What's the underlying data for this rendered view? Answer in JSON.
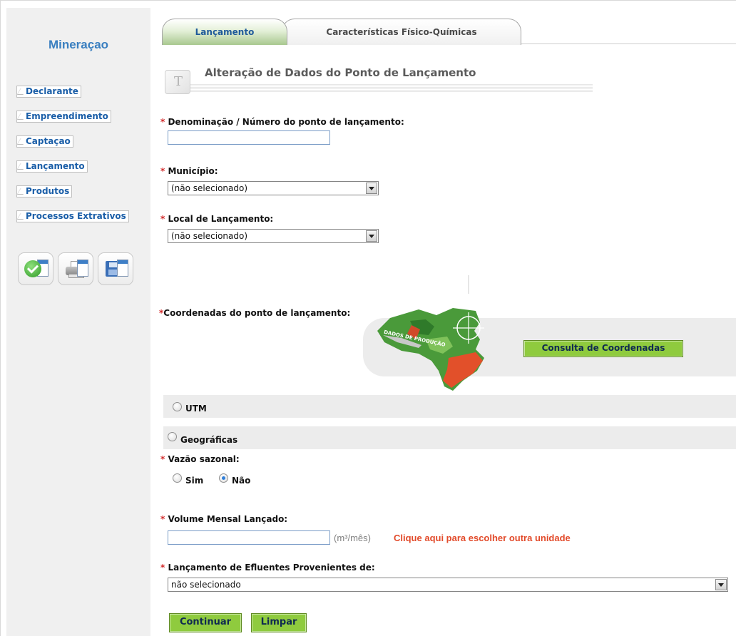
{
  "sidebar": {
    "title": "Mineraçao",
    "items": [
      {
        "label": "Declarante"
      },
      {
        "label": "Empreendimento"
      },
      {
        "label": "Captaçao"
      },
      {
        "label": "Lançamento"
      },
      {
        "label": "Produtos"
      },
      {
        "label": "Processos Extrativos"
      }
    ],
    "tools": [
      "check-window-icon",
      "printer-icon",
      "save-disk-icon"
    ]
  },
  "tabs": [
    {
      "label": "Lançamento",
      "active": true
    },
    {
      "label": "Características Físico-Químicas",
      "active": false
    }
  ],
  "section": {
    "title": "Alteração de Dados do Ponto de Lançamento",
    "icon_letter": "T"
  },
  "form": {
    "required_mark": "*",
    "denominacao": {
      "label": "Denominação / Número do ponto de lançamento:",
      "value": ""
    },
    "municipio": {
      "label": "Município:",
      "selected": "(não selecionado)"
    },
    "local": {
      "label": "Local de Lançamento:",
      "selected": "(não selecionado)"
    },
    "coordenadas": {
      "label": "Coordenadas do ponto de lançamento:",
      "consulta_button": "Consulta de Coordenadas",
      "map_text": "DADOS DE PRODUÇÃO",
      "options": [
        {
          "label": "UTM",
          "checked": false
        },
        {
          "label": "Geográficas",
          "checked": false
        }
      ]
    },
    "vazao": {
      "label": "Vazão sazonal:",
      "options": [
        {
          "label": "Sim",
          "checked": false
        },
        {
          "label": "Não",
          "checked": true
        }
      ]
    },
    "volume": {
      "label": "Volume Mensal Lançado:",
      "value": "",
      "unit": "(m³/mês)",
      "unit_link": "Clique aqui para escolher outra unidade"
    },
    "efluentes": {
      "label": "Lançamento de Efluentes Provenientes de:",
      "selected": "não selecionado"
    }
  },
  "actions": {
    "continuar": "Continuar",
    "limpar": "Limpar"
  },
  "colors": {
    "accent_green": "#8fcb3e",
    "link_red": "#e24a2a",
    "nav_blue": "#1a5ea8",
    "required": "#d22a2a"
  }
}
